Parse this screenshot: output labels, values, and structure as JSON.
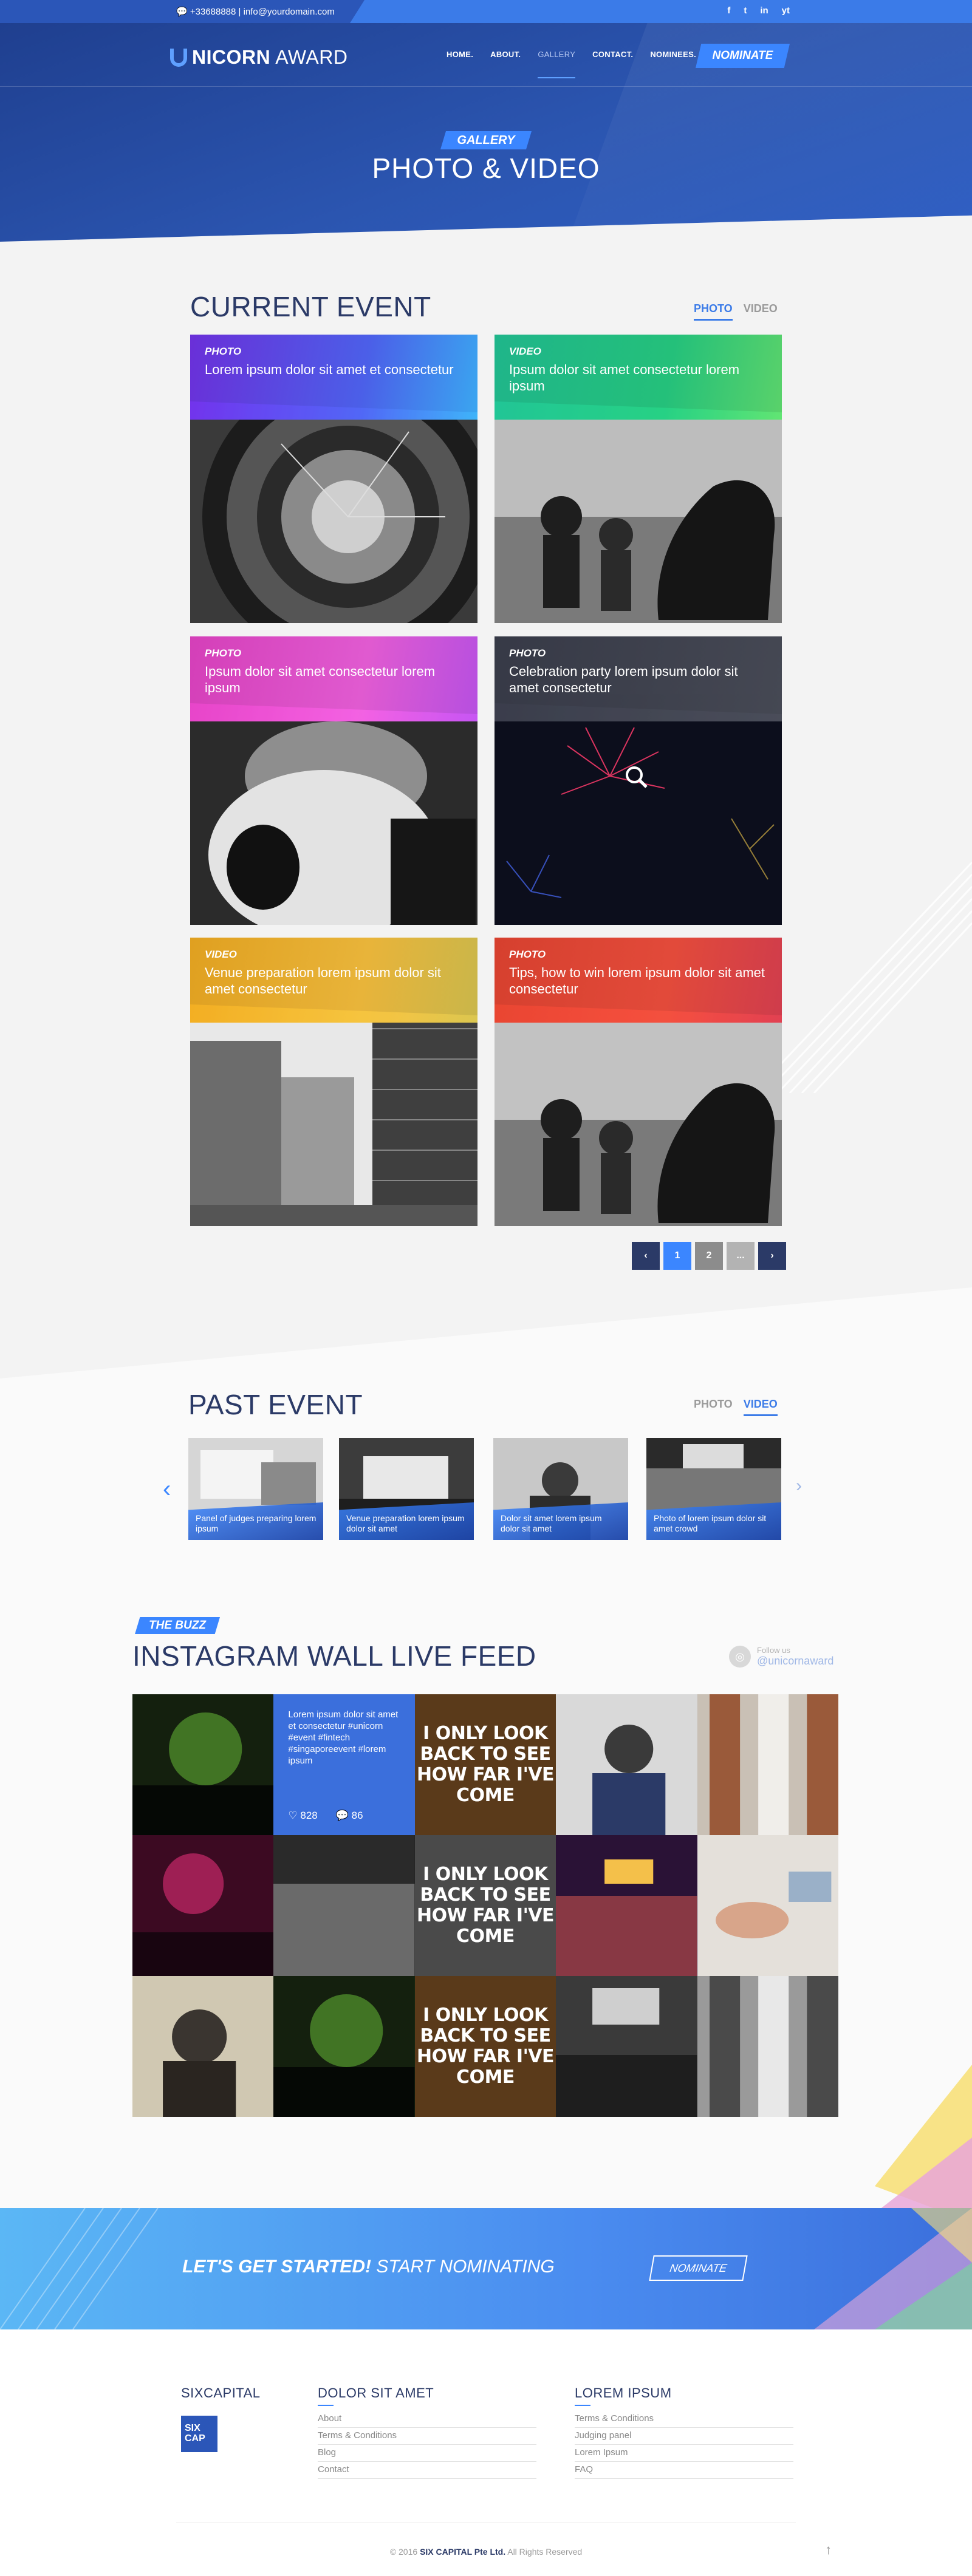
{
  "topbar": {
    "contact": "💬 +33688888 | info@yourdomain.com",
    "socials": [
      "f",
      "t",
      "in",
      "yt"
    ]
  },
  "header": {
    "logo_part1": "NICORN",
    "logo_part2": "AWARD",
    "nav": [
      "HOME.",
      "ABOUT.",
      "GALLERY",
      "CONTACT.",
      "NOMINEES."
    ],
    "nominate": "NOMINATE",
    "badge": "GALLERY",
    "title": "PHOTO & VIDEO"
  },
  "current_event": {
    "title": "CURRENT EVENT",
    "tabs": [
      "PHOTO",
      "VIDEO"
    ],
    "cards": [
      {
        "type": "PHOTO",
        "title": "Lorem ipsum dolor sit amet et consectetur"
      },
      {
        "type": "VIDEO",
        "title": "Ipsum dolor sit amet consectetur lorem ipsum"
      },
      {
        "type": "PHOTO",
        "title": "Ipsum dolor sit amet consectetur lorem ipsum"
      },
      {
        "type": "PHOTO",
        "title": "Celebration party lorem ipsum dolor sit amet consectetur"
      },
      {
        "type": "VIDEO",
        "title": "Venue preparation lorem ipsum dolor sit amet consectetur"
      },
      {
        "type": "PHOTO",
        "title": "Tips, how to win lorem ipsum dolor sit amet consectetur"
      }
    ],
    "pagination": [
      "‹",
      "1",
      "2",
      "...",
      "›"
    ]
  },
  "past_event": {
    "title": "PAST EVENT",
    "tabs": [
      "PHOTO",
      "VIDEO"
    ],
    "items": [
      "Panel of judges preparing lorem ipsum",
      "Venue preparation lorem ipsum dolor sit amet",
      "Dolor sit amet lorem ipsum dolor sit amet",
      "Photo of lorem ipsum dolor sit amet crowd"
    ],
    "prev": "‹",
    "next": "›"
  },
  "buzz": {
    "badge": "THE BUZZ",
    "title": "INSTAGRAM WALL LIVE FEED",
    "follow_small": "Follow us",
    "follow_user": "@unicornaward",
    "highlight_text": "Lorem ipsum dolor sit amet et consectetur #unicorn #event #fintech #singaporeevent #lorem ipsum",
    "likes": "828",
    "comments": "86",
    "quote": "I ONLY LOOK BACK TO SEE HOW FAR I'VE COME"
  },
  "cta": {
    "bold": "LET'S GET STARTED!",
    "rest": "START NOMINATING",
    "button": "NOMINATE"
  },
  "footer": {
    "col1_title": "SIXCAPITAL",
    "logo_line1": "SIX",
    "logo_line2": "CAP",
    "col2_title": "DOLOR SIT AMET",
    "col2_links": [
      "About",
      "Terms & Conditions",
      "Blog",
      "Contact"
    ],
    "col3_title": "LOREM IPSUM",
    "col3_links": [
      "Terms & Conditions",
      "Judging panel",
      "Lorem Ipsum",
      "FAQ"
    ],
    "copyright_pre": "© 2016",
    "copyright_bold": "SIX CAPITAL Pte Ltd.",
    "copyright_post": "All Rights Reserved",
    "to_top": "↑"
  }
}
